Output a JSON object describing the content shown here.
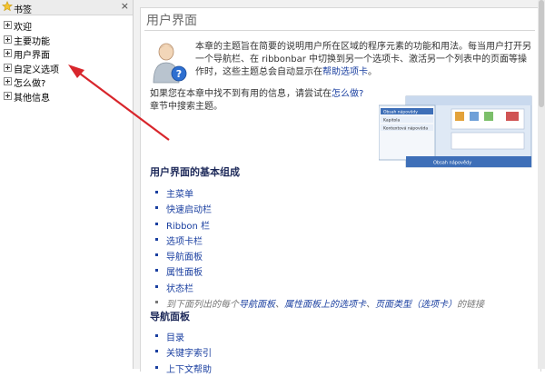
{
  "sidebar": {
    "title": "书签",
    "close_label": "×",
    "items": [
      {
        "label": "欢迎"
      },
      {
        "label": "主要功能"
      },
      {
        "label": "用户界面"
      },
      {
        "label": "自定义选项"
      },
      {
        "label": "怎么做?"
      },
      {
        "label": "其他信息"
      }
    ]
  },
  "page": {
    "title": "用户界面",
    "intro_part1": "本章的主题旨在简要的说明用户所在区域的程序元素的功能和用法。每当用户打开另一个导航栏、在 ribbonbar 中切换到另一个选项卡、激活另一个列表中的页面等操作时，这些主题总会自动显示在",
    "intro_link": "帮助选项卡",
    "intro_end": "。",
    "hint_part1": "如果您在本章中找不到有用的信息，请尝试在",
    "hint_link": "怎么做?",
    "hint_part2": "章节中搜索主题。",
    "section1_title": "用户界面的基本组成",
    "section1_items": [
      "主菜单",
      "快速启动栏",
      "Ribbon 栏",
      "选项卡栏",
      "导航面板",
      "属性面板",
      "状态栏"
    ],
    "note_prefix": "到下面列出的每个",
    "note_link1": "导航面板",
    "note_sep1": "、",
    "note_link2": "属性面板上的选项卡",
    "note_sep2": "、",
    "note_link3": "页面类型（选项卡）",
    "note_suffix": "的链接",
    "section2_title": "导航面板",
    "section2_items": [
      "目录",
      "关键字索引",
      "上下文帮助"
    ]
  },
  "thumbnail": {
    "label1": "Obsah nápovědy",
    "label2": "Kapitola",
    "label3": "Kontextová nápověda",
    "label4": "Obsah nápovědy"
  },
  "colors": {
    "link": "#1a3fa0",
    "heading": "#1e2a5a",
    "arrow": "#d8262c"
  }
}
